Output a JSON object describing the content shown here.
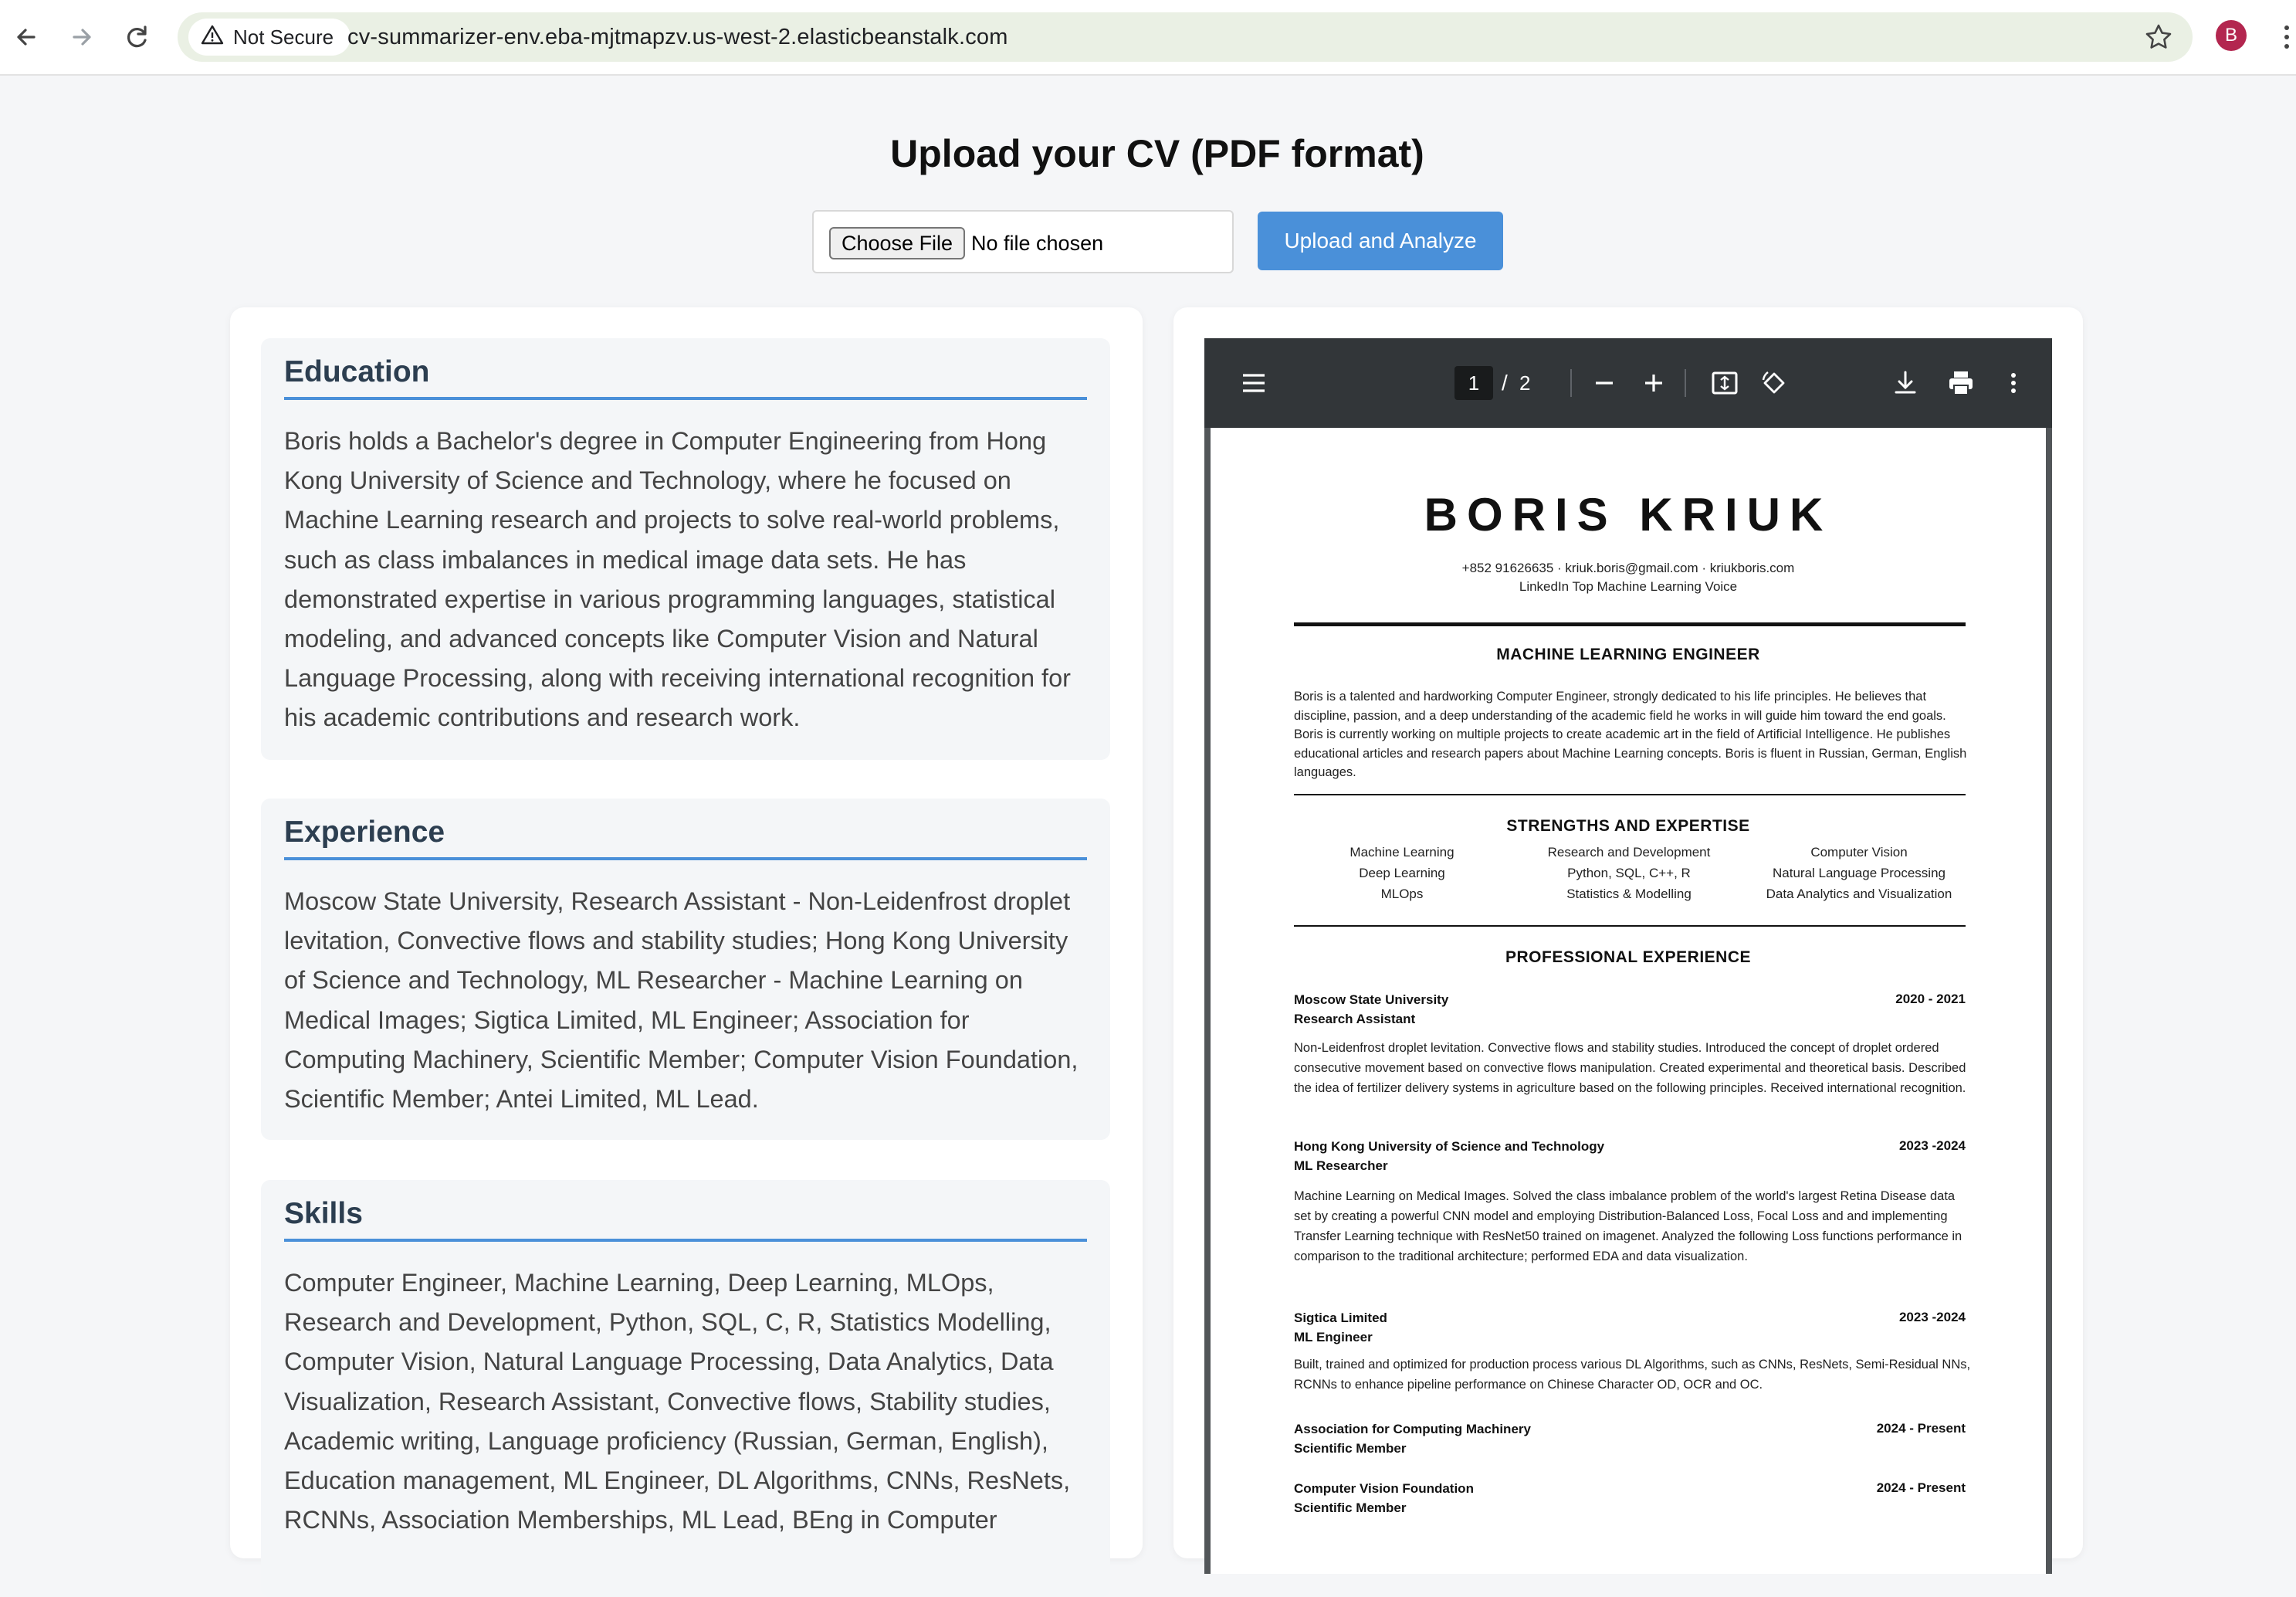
{
  "browser": {
    "security_label": "Not Secure",
    "url": "cv-summarizer-env.eba-mjtmapzv.us-west-2.elasticbeanstalk.com",
    "profile_initial": "B"
  },
  "page": {
    "title": "Upload your CV (PDF format)",
    "choose_file_label": "Choose File",
    "no_file_label": "No file chosen",
    "submit_label": "Upload and Analyze"
  },
  "summary": {
    "sections": [
      {
        "title": "Education",
        "text": "Boris holds a Bachelor's degree in Computer Engineering from Hong Kong University of Science and Technology, where he focused on Machine Learning research and projects to solve real-world problems, such as class imbalances in medical image data sets. He has demonstrated expertise in various programming languages, statistical modeling, and advanced concepts like Computer Vision and Natural Language Processing, along with receiving international recognition for his academic contributions and research work."
      },
      {
        "title": "Experience",
        "text": "Moscow State University, Research Assistant - Non-Leidenfrost droplet levitation, Convective flows and stability studies; Hong Kong University of Science and Technology, ML Researcher - Machine Learning on Medical Images; Sigtica Limited, ML Engineer; Association for Computing Machinery, Scientific Member; Computer Vision Foundation, Scientific Member; Antei Limited, ML Lead."
      },
      {
        "title": "Skills",
        "text": "Computer Engineer, Machine Learning, Deep Learning, MLOps, Research and Development, Python, SQL, C, R, Statistics Modelling, Computer Vision, Natural Language Processing, Data Analytics, Data Visualization, Research Assistant, Convective flows, Stability studies, Academic writing, Language proficiency (Russian, German, English), Education management, ML Engineer, DL Algorithms, CNNs, ResNets, RCNNs, Association Memberships, ML Lead, BEng in Computer"
      }
    ]
  },
  "pdf_viewer": {
    "current_page": "1",
    "separator": "/",
    "total_pages": "2",
    "cv": {
      "name": "BORIS KRIUK",
      "contact": "+852 91626635 · kriuk.boris@gmail.com · kriukboris.com",
      "tagline": "LinkedIn Top Machine Learning Voice",
      "role": "MACHINE LEARNING ENGINEER",
      "summary": "Boris is a talented and hardworking Computer Engineer, strongly dedicated to his life principles. He believes that discipline, passion, and a deep understanding of the academic field he works in will guide him toward the end goals. Boris is currently working on multiple projects to create academic art in the field of Artificial Intelligence. He publishes educational articles and research papers about Machine Learning concepts. Boris is fluent in Russian, German, English languages.",
      "strengths_heading": "STRENGTHS AND EXPERTISE",
      "strengths": [
        [
          "Machine Learning",
          "Deep Learning",
          "MLOps"
        ],
        [
          "Research and Development",
          "Python, SQL, C++, R",
          "Statistics & Modelling"
        ],
        [
          "Computer Vision",
          "Natural Language Processing",
          "Data Analytics and Visualization"
        ]
      ],
      "experience_heading": "PROFESSIONAL EXPERIENCE",
      "jobs": [
        {
          "org": "Moscow State University",
          "title": "Research Assistant",
          "dates": "2020 - 2021",
          "desc": "Non-Leidenfrost droplet levitation. Convective flows and stability studies. Introduced the concept of droplet ordered consecutive movement based on convective flows manipulation. Created experimental and theoretical basis. Described the idea of fertilizer delivery systems in agriculture based on the following principles. Received international recognition."
        },
        {
          "org": "Hong Kong University of Science and Technology",
          "title": "ML Researcher",
          "dates": "2023 -2024",
          "desc": "Machine Learning on Medical Images. Solved the class imbalance problem of the world's largest Retina Disease data set by creating a powerful CNN model and employing Distribution-Balanced Loss, Focal Loss and and implementing Transfer Learning technique with ResNet50 trained on imagenet. Analyzed the following Loss functions performance in comparison to the traditional architecture; performed EDA and data visualization."
        },
        {
          "org": "Sigtica Limited",
          "title": "ML Engineer",
          "dates": "2023 -2024",
          "desc": "Built, trained and optimized for production process various DL Algorithms, such as CNNs, ResNets, Semi-Residual NNs, RCNNs to enhance pipeline performance on Chinese Character OD, OCR and OC."
        },
        {
          "org": "Association for Computing Machinery",
          "title": "Scientific Member",
          "dates": "2024 - Present",
          "desc": ""
        },
        {
          "org": "Computer Vision Foundation",
          "title": "Scientific Member",
          "dates": "2024 - Present",
          "desc": ""
        }
      ]
    }
  }
}
